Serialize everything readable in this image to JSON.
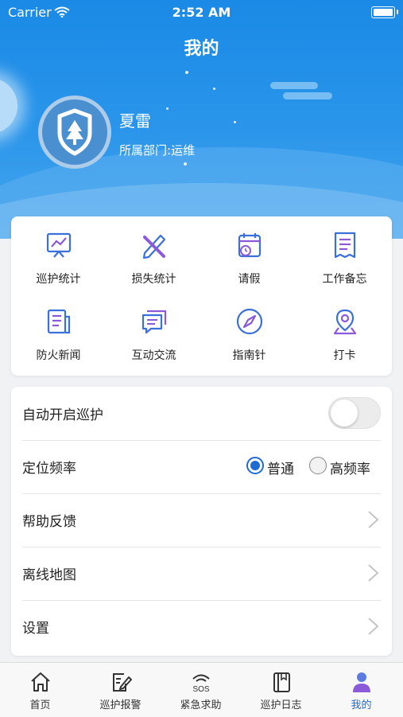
{
  "status_bar": {
    "carrier": "Carrier",
    "time": "2:52 AM"
  },
  "header": {
    "title": "我的"
  },
  "profile": {
    "name": "夏雷",
    "department_label": "所属部门:",
    "department": "运维"
  },
  "grid": [
    {
      "label": "巡护统计",
      "icon": "chart-board-icon"
    },
    {
      "label": "损失统计",
      "icon": "pencil-ruler-icon"
    },
    {
      "label": "请假",
      "icon": "calendar-clock-icon"
    },
    {
      "label": "工作备忘",
      "icon": "memo-icon"
    },
    {
      "label": "防火新闻",
      "icon": "news-icon"
    },
    {
      "label": "互动交流",
      "icon": "chat-icon"
    },
    {
      "label": "指南针",
      "icon": "compass-icon"
    },
    {
      "label": "打卡",
      "icon": "location-pin-icon"
    }
  ],
  "settings": {
    "auto_patrol": {
      "label": "自动开启巡护",
      "enabled": false
    },
    "location_freq": {
      "label": "定位频率",
      "options": [
        "普通",
        "高频率"
      ],
      "selected": "普通"
    },
    "help": {
      "label": "帮助反馈"
    },
    "offline_map": {
      "label": "离线地图"
    },
    "settings": {
      "label": "设置"
    }
  },
  "tabs": [
    {
      "label": "首页",
      "icon": "home-icon"
    },
    {
      "label": "巡护报警",
      "icon": "report-edit-icon"
    },
    {
      "label": "紧急求助",
      "icon": "sos-icon",
      "icon_text": "SOS"
    },
    {
      "label": "巡护日志",
      "icon": "logbook-icon"
    },
    {
      "label": "我的",
      "icon": "user-icon",
      "active": true
    }
  ],
  "colors": {
    "accent": "#1e6bd6",
    "header": "#1a8ae6",
    "icon_blue": "#3b6fd9",
    "icon_purple": "#8a5ad8"
  }
}
